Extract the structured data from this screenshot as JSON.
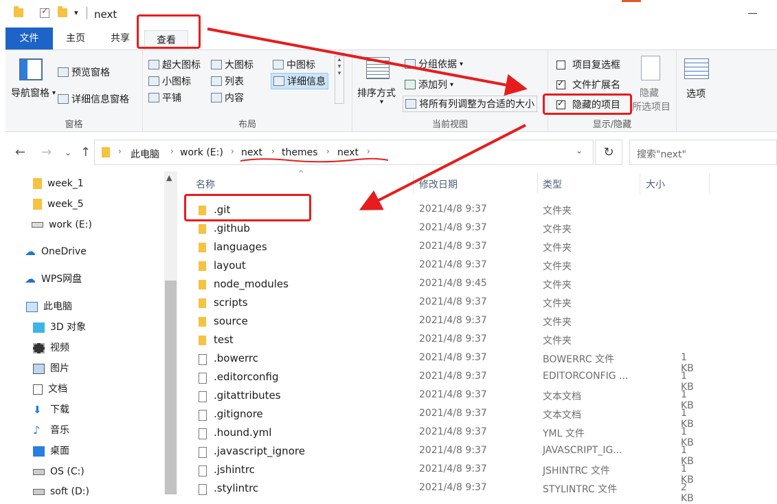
{
  "window": {
    "title": "next"
  },
  "ribbon_tabs": {
    "file": "文件",
    "home": "主页",
    "share": "共享",
    "view": "查看"
  },
  "ribbon": {
    "panes": {
      "nav_pane": "导航窗格",
      "preview_pane": "预览窗格",
      "details_pane": "详细信息窗格",
      "label": "窗格"
    },
    "layout": {
      "xl_icons": "超大图标",
      "large_icons": "大图标",
      "medium_icons": "中图标",
      "small_icons": "小图标",
      "list": "列表",
      "details": "详细信息",
      "tiles": "平铺",
      "content": "内容",
      "label": "布局"
    },
    "current_view": {
      "sort_by": "排序方式",
      "group_by": "分组依据",
      "add_columns": "添加列",
      "size_all_columns": "将所有列调整为合适的大小",
      "label": "当前视图"
    },
    "show_hide": {
      "item_checkboxes": "项目复选框",
      "file_extensions": "文件扩展名",
      "hidden_items": "隐藏的项目",
      "hide_selected_1": "隐藏",
      "hide_selected_2": "所选项目",
      "options": "选项",
      "label": "显示/隐藏",
      "item_checkboxes_checked": false,
      "file_extensions_checked": true,
      "hidden_items_checked": true
    }
  },
  "address": {
    "crumbs": [
      "此电脑",
      "work (E:)",
      "next",
      "themes",
      "next"
    ],
    "search_placeholder": "搜索\"next\""
  },
  "nav_items": [
    {
      "label": "week_1",
      "icon": "folder-icon"
    },
    {
      "label": "week_5",
      "icon": "folder-icon"
    },
    {
      "label": "work (E:)",
      "icon": "drive-icon"
    },
    {
      "label": "OneDrive",
      "icon": "cloud-icon"
    },
    {
      "label": "WPS网盘",
      "icon": "cloud-icon"
    },
    {
      "label": "此电脑",
      "icon": "computer-icon"
    },
    {
      "label": "3D 对象",
      "icon": "cube-icon"
    },
    {
      "label": "视频",
      "icon": "video-icon"
    },
    {
      "label": "图片",
      "icon": "picture-icon"
    },
    {
      "label": "文档",
      "icon": "document-icon"
    },
    {
      "label": "下载",
      "icon": "download-icon"
    },
    {
      "label": "音乐",
      "icon": "music-icon"
    },
    {
      "label": "桌面",
      "icon": "desktop-icon"
    },
    {
      "label": "OS (C:)",
      "icon": "drive-icon"
    },
    {
      "label": "soft (D:)",
      "icon": "drive-icon"
    }
  ],
  "columns": {
    "name": "名称",
    "date": "修改日期",
    "type": "类型",
    "size": "大小"
  },
  "files": [
    {
      "name": ".git",
      "date": "2021/4/8 9:37",
      "type": "文件夹",
      "size": "",
      "kind": "folder"
    },
    {
      "name": ".github",
      "date": "2021/4/8 9:37",
      "type": "文件夹",
      "size": "",
      "kind": "folder"
    },
    {
      "name": "languages",
      "date": "2021/4/8 9:37",
      "type": "文件夹",
      "size": "",
      "kind": "folder"
    },
    {
      "name": "layout",
      "date": "2021/4/8 9:37",
      "type": "文件夹",
      "size": "",
      "kind": "folder"
    },
    {
      "name": "node_modules",
      "date": "2021/4/8 9:45",
      "type": "文件夹",
      "size": "",
      "kind": "folder"
    },
    {
      "name": "scripts",
      "date": "2021/4/8 9:37",
      "type": "文件夹",
      "size": "",
      "kind": "folder"
    },
    {
      "name": "source",
      "date": "2021/4/8 9:37",
      "type": "文件夹",
      "size": "",
      "kind": "folder"
    },
    {
      "name": "test",
      "date": "2021/4/8 9:37",
      "type": "文件夹",
      "size": "",
      "kind": "folder"
    },
    {
      "name": ".bowerrc",
      "date": "2021/4/8 9:37",
      "type": "BOWERRC 文件",
      "size": "1 KB",
      "kind": "file"
    },
    {
      "name": ".editorconfig",
      "date": "2021/4/8 9:37",
      "type": "EDITORCONFIG ...",
      "size": "1 KB",
      "kind": "file"
    },
    {
      "name": ".gitattributes",
      "date": "2021/4/8 9:37",
      "type": "文本文档",
      "size": "1 KB",
      "kind": "file"
    },
    {
      "name": ".gitignore",
      "date": "2021/4/8 9:37",
      "type": "文本文档",
      "size": "1 KB",
      "kind": "file"
    },
    {
      "name": ".hound.yml",
      "date": "2021/4/8 9:37",
      "type": "YML 文件",
      "size": "1 KB",
      "kind": "file"
    },
    {
      "name": ".javascript_ignore",
      "date": "2021/4/8 9:37",
      "type": "JAVASCRIPT_IG...",
      "size": "1 KB",
      "kind": "file"
    },
    {
      "name": ".jshintrc",
      "date": "2021/4/8 9:37",
      "type": "JSHINTRC 文件",
      "size": "1 KB",
      "kind": "file"
    },
    {
      "name": ".stylintrc",
      "date": "2021/4/8 9:37",
      "type": "STYLINTRC 文件",
      "size": "2 KB",
      "kind": "file"
    }
  ],
  "annotation_color": "#e61d1d"
}
